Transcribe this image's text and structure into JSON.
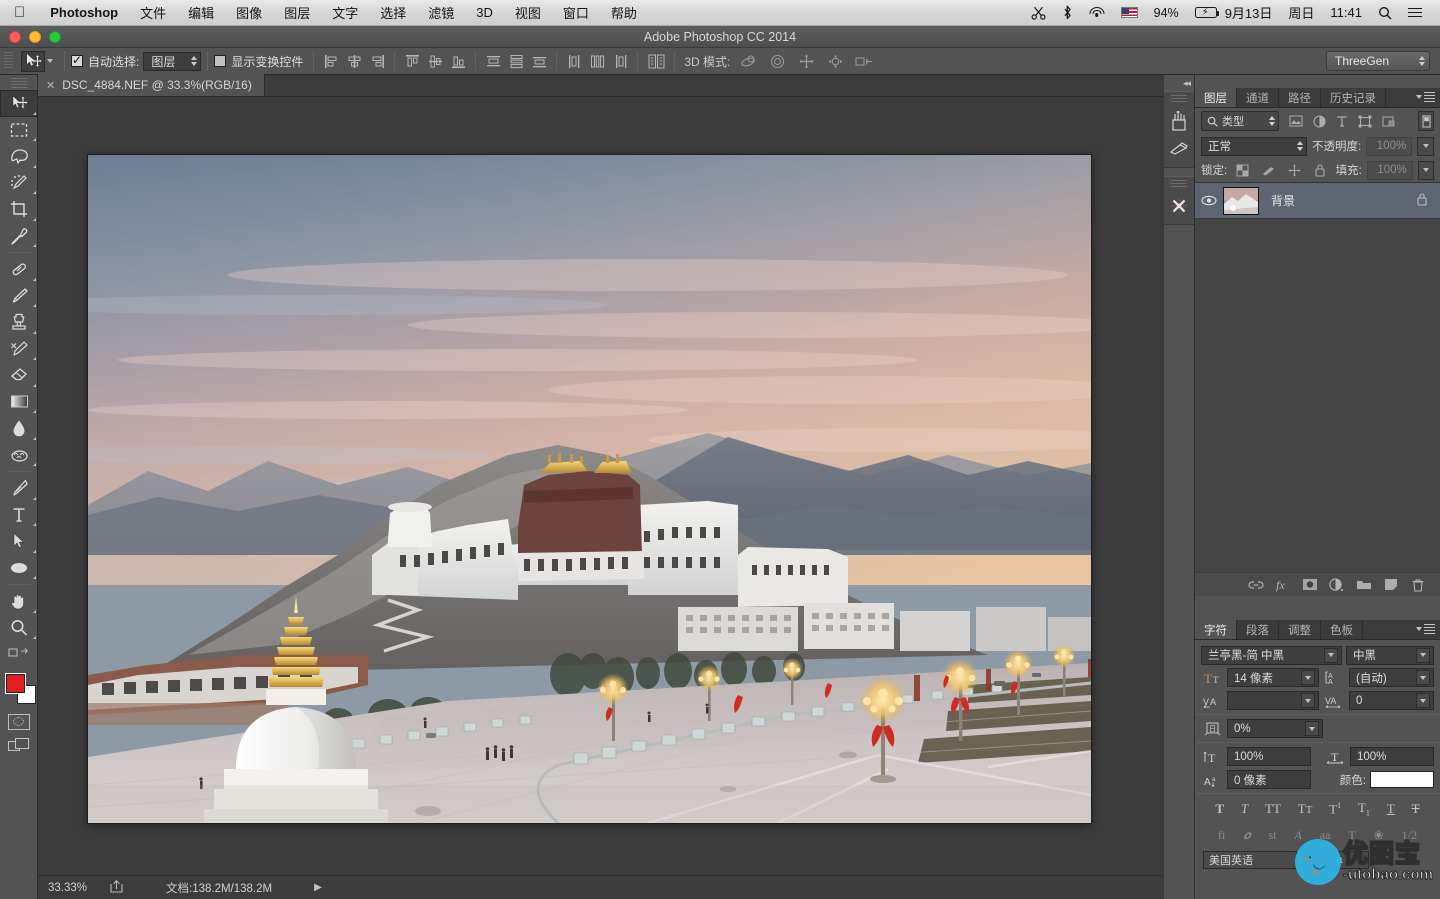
{
  "macmenu": {
    "apple_icon": "apple-icon",
    "app_name": "Photoshop",
    "items": [
      "文件",
      "编辑",
      "图像",
      "图层",
      "文字",
      "选择",
      "滤镜",
      "3D",
      "视图",
      "窗口",
      "帮助"
    ],
    "status": {
      "scissors_icon": "scissors-icon",
      "bluetooth_icon": "bluetooth-icon",
      "wifi_icon": "wifi-icon",
      "flag_icon": "us-flag-icon",
      "battery_percent": "94%",
      "battery_icon": "battery-charging-icon",
      "date": "9月13日",
      "weekday": "周日",
      "time": "11:41",
      "search_icon": "search-icon",
      "notification_icon": "notification-center-icon"
    }
  },
  "window": {
    "title": "Adobe Photoshop CC 2014",
    "close_label": "close",
    "minimize_label": "minimize",
    "zoom_label": "zoom"
  },
  "options_bar": {
    "tool_icon": "move-tool-icon",
    "auto_select_label": "自动选择:",
    "auto_select_checked": true,
    "auto_select_value": "图层",
    "show_transform_label": "显示变换控件",
    "show_transform_checked": false,
    "align_group_1": [
      "align-left-edges-icon",
      "align-horizontal-centers-icon",
      "align-right-edges-icon"
    ],
    "align_group_2": [
      "align-top-edges-icon",
      "align-vertical-centers-icon",
      "align-bottom-edges-icon"
    ],
    "distribute_group_1": [
      "distribute-top-edges-icon",
      "distribute-vertical-centers-icon",
      "distribute-bottom-edges-icon"
    ],
    "distribute_group_2": [
      "distribute-left-edges-icon",
      "distribute-horizontal-centers-icon",
      "distribute-right-edges-icon"
    ],
    "auto_align_icon": "auto-align-layers-icon",
    "mode_3d_label": "3D 模式:",
    "mode_3d_icons": [
      "orbit-3d-icon",
      "roll-3d-icon",
      "pan-3d-icon",
      "slide-3d-icon",
      "scale-3d-icon"
    ],
    "workspace": "ThreeGen"
  },
  "tools": [
    {
      "name": "move-tool",
      "selected": true
    },
    {
      "name": "rectangular-marquee-tool",
      "selected": false
    },
    {
      "name": "lasso-tool",
      "selected": false
    },
    {
      "name": "quick-selection-tool",
      "selected": false
    },
    {
      "name": "crop-tool",
      "selected": false
    },
    {
      "name": "eyedropper-tool",
      "selected": false
    },
    {
      "name": "spot-healing-brush-tool",
      "selected": false
    },
    {
      "name": "brush-tool",
      "selected": false
    },
    {
      "name": "clone-stamp-tool",
      "selected": false
    },
    {
      "name": "history-brush-tool",
      "selected": false
    },
    {
      "name": "eraser-tool",
      "selected": false
    },
    {
      "name": "gradient-tool",
      "selected": false
    },
    {
      "name": "blur-tool",
      "selected": false
    },
    {
      "name": "dodge-tool",
      "selected": false
    },
    {
      "name": "pen-tool",
      "selected": false
    },
    {
      "name": "type-tool",
      "selected": false
    },
    {
      "name": "path-selection-tool",
      "selected": false
    },
    {
      "name": "ellipse-shape-tool",
      "selected": false
    },
    {
      "name": "hand-tool",
      "selected": false
    },
    {
      "name": "zoom-tool",
      "selected": false
    }
  ],
  "color_swatches": {
    "foreground": "#e02020",
    "background": "#ffffff",
    "quick_mask_icon": "quick-mask-icon",
    "screen_mode_icon": "screen-mode-icon"
  },
  "document": {
    "tab_title": "DSC_4884.NEF @ 33.3%(RGB/16)",
    "close_icon": "close-tab-icon"
  },
  "status_bar": {
    "zoom": "33.33%",
    "share_icon": "share-icon",
    "doc_info": "文档:138.2M/138.2M",
    "expand_icon": "expand-arrow-icon"
  },
  "mini_dock": {
    "collapse_icon": "collapse-panels-icon",
    "items": [
      "tool-presets-icon",
      "brush-presets-icon",
      "3d-panel-icon"
    ]
  },
  "layers_panel": {
    "tabs": [
      {
        "label": "图层",
        "active": true
      },
      {
        "label": "通道",
        "active": false
      },
      {
        "label": "路径",
        "active": false
      },
      {
        "label": "历史记录",
        "active": false
      }
    ],
    "menu_icon": "panel-menu-icon",
    "filter": {
      "search_icon": "search-icon",
      "kind_label": "类型",
      "icons": [
        "filter-pixel-icon",
        "filter-adjustment-icon",
        "filter-type-icon",
        "filter-shape-icon",
        "filter-smart-object-icon"
      ],
      "toggle_icon": "filter-toggle-icon"
    },
    "blend_mode": "正常",
    "opacity_label": "不透明度:",
    "opacity_value": "100%",
    "lock_label": "锁定:",
    "lock_icons": [
      "lock-transparent-pixels-icon",
      "lock-image-pixels-icon",
      "lock-position-icon",
      "lock-all-icon"
    ],
    "fill_label": "填充:",
    "fill_value": "100%",
    "layers": [
      {
        "name": "背景",
        "visible": true,
        "locked": true,
        "selected": true,
        "eye_icon": "eye-icon",
        "lock_icon": "lock-icon",
        "thumbnail": "layer-thumbnail"
      }
    ],
    "footer_buttons": [
      "link-layers-icon",
      "layer-style-fx-icon",
      "add-layer-mask-icon",
      "new-adjustment-layer-icon",
      "new-group-icon",
      "new-layer-icon",
      "delete-layer-icon"
    ]
  },
  "character_panel": {
    "tabs": [
      {
        "label": "字符",
        "active": true
      },
      {
        "label": "段落",
        "active": false
      },
      {
        "label": "调整",
        "active": false
      },
      {
        "label": "色板",
        "active": false
      }
    ],
    "menu_icon": "panel-menu-icon",
    "font_family": "兰亭黑-简 中黑",
    "font_style": "中黑",
    "size_icon": "font-size-icon",
    "font_size": "14 像素",
    "leading_icon": "leading-icon",
    "leading": "(自动)",
    "kerning_icon": "kerning-icon",
    "kerning": "",
    "tracking_icon": "tracking-icon",
    "tracking": "0",
    "vertical_scale_icon": "vertical-scale-icon",
    "vertical_scale": "100%",
    "horizontal_scale_icon": "horizontal-scale-icon",
    "horizontal_scale": "100%",
    "baseline_icon": "baseline-shift-icon",
    "baseline_shift": "0 像素",
    "tsume_icon": "tsume-icon",
    "tsume": "0%",
    "color_label": "颜色:",
    "color_value": "#ffffff",
    "style_buttons": [
      "faux-bold-icon",
      "faux-italic-icon",
      "all-caps-icon",
      "small-caps-icon",
      "superscript-icon",
      "subscript-icon",
      "underline-icon",
      "strikethrough-icon"
    ],
    "opentype_buttons": [
      "standard-ligatures-icon",
      "contextual-alternates-icon",
      "discretionary-ligatures-icon",
      "swash-icon",
      "oldstyle-icon",
      "stylistic-alternates-icon",
      "ornaments-icon",
      "titling-alternates-icon"
    ],
    "language": "美国英语",
    "antialias_icon": "anti-alias-icon"
  },
  "watermark": {
    "logo_icon": "bird-logo-icon",
    "chinese": "优图宝",
    "url": "-utobao.com"
  },
  "photo": {
    "description": "potala-palace-lhasa-sunset"
  },
  "colors": {
    "panel_bg": "#535353",
    "panel_dark": "#3b3b3b",
    "field_bg": "#3e3e3e",
    "selected_layer": "#5d6573",
    "accent_red": "#e02020"
  }
}
